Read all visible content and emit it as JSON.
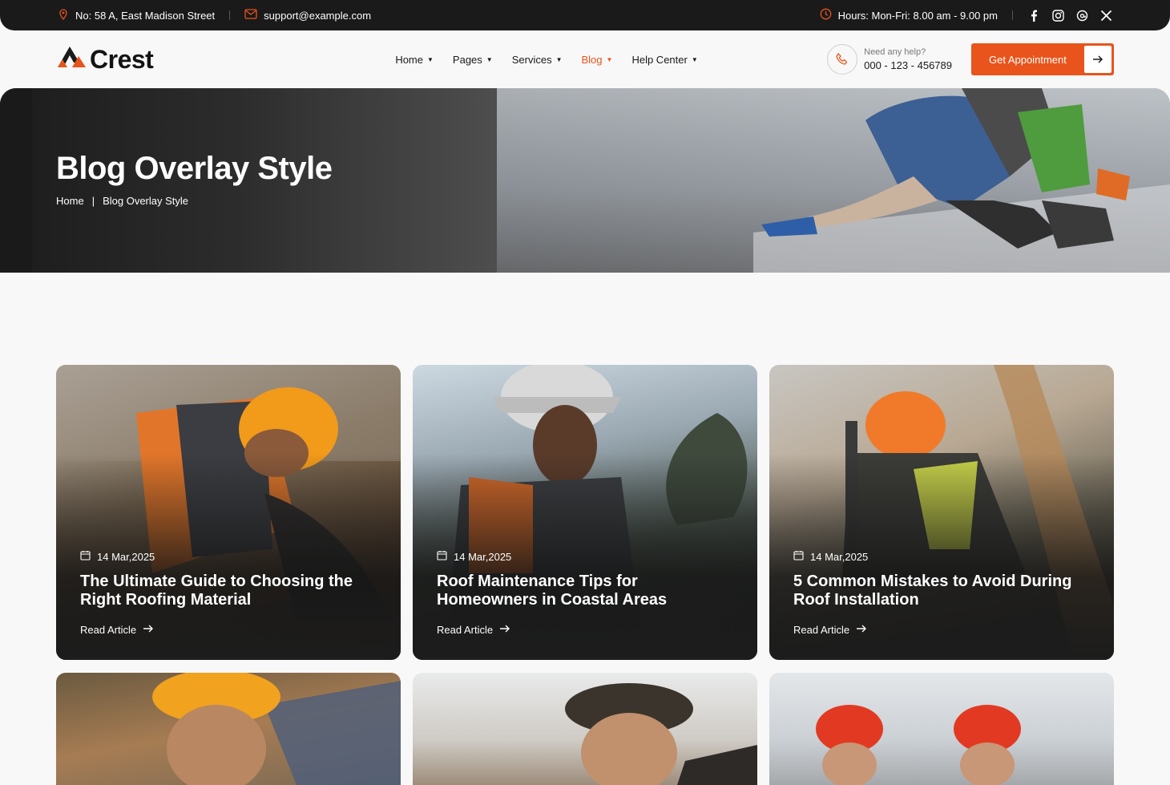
{
  "topbar": {
    "address": "No: 58 A, East Madison Street",
    "email": "support@example.com",
    "hours": "Hours: Mon-Fri: 8.00 am - 9.00 pm"
  },
  "header": {
    "logo": "Crest",
    "nav": [
      {
        "label": "Home",
        "active": false
      },
      {
        "label": "Pages",
        "active": false
      },
      {
        "label": "Services",
        "active": false
      },
      {
        "label": "Blog",
        "active": true
      },
      {
        "label": "Help Center",
        "active": false
      }
    ],
    "help_label": "Need any help?",
    "help_phone": "000 - 123 - 456789",
    "cta_label": "Get Appointment"
  },
  "hero": {
    "title": "Blog Overlay Style",
    "breadcrumb_home": "Home",
    "breadcrumb_separator": "|",
    "breadcrumb_current": "Blog Overlay Style"
  },
  "posts": [
    {
      "date": "14 Mar,2025",
      "title": "The Ultimate Guide to Choosing the Right Roofing Material",
      "link": "Read Article"
    },
    {
      "date": "14 Mar,2025",
      "title": "Roof Maintenance Tips for Homeowners in Coastal Areas",
      "link": "Read Article"
    },
    {
      "date": "14 Mar,2025",
      "title": "5 Common Mistakes to Avoid During Roof Installation",
      "link": "Read Article"
    }
  ],
  "colors": {
    "accent": "#e8541b",
    "dark": "#1a1a1a"
  },
  "icons": [
    "location-pin-icon",
    "mail-icon",
    "clock-icon",
    "facebook-icon",
    "instagram-icon",
    "threads-icon",
    "x-icon",
    "phone-icon",
    "arrow-right-icon",
    "calendar-icon",
    "chevron-down-icon"
  ]
}
